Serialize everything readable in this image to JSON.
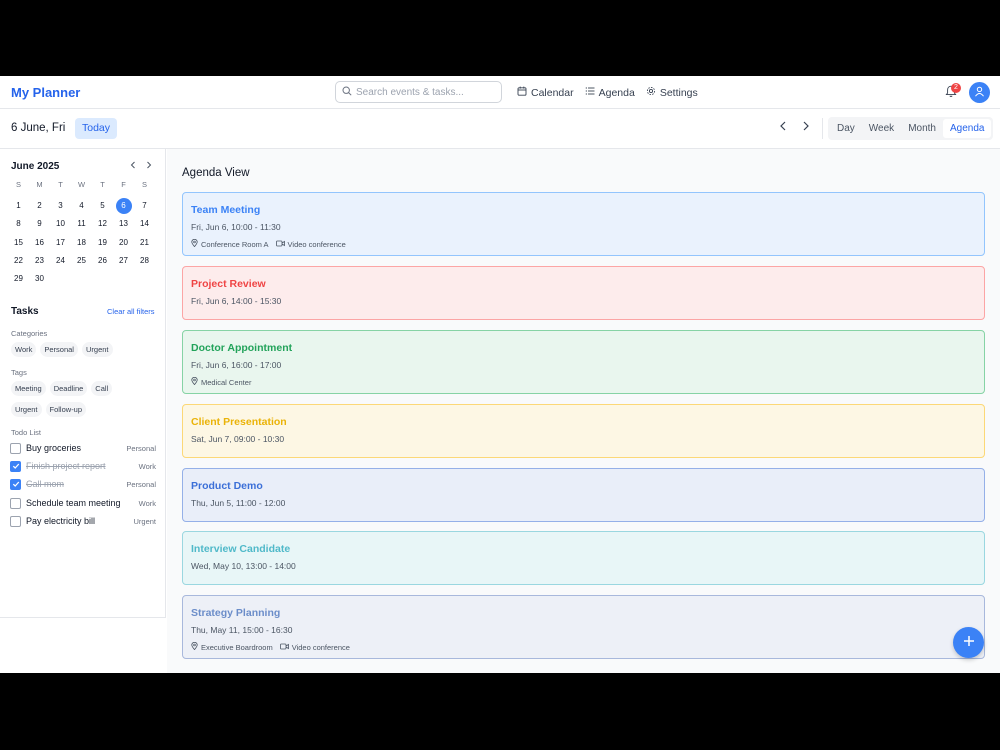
{
  "header": {
    "brand": "My Planner",
    "search_placeholder": "Search events & tasks...",
    "nav": [
      {
        "label": "Calendar",
        "icon": "calendar-icon"
      },
      {
        "label": "Agenda",
        "icon": "list-icon"
      },
      {
        "label": "Settings",
        "icon": "gear-icon"
      }
    ],
    "notification_count": "2"
  },
  "toolbar": {
    "current_date": "6 June, Fri",
    "today_label": "Today",
    "views": [
      "Day",
      "Week",
      "Month",
      "Agenda"
    ],
    "active_view": "Agenda"
  },
  "mini_calendar": {
    "title": "June 2025",
    "weekdays": [
      "S",
      "M",
      "T",
      "W",
      "T",
      "F",
      "S"
    ],
    "days": [
      "1",
      "2",
      "3",
      "4",
      "5",
      "6",
      "7",
      "8",
      "9",
      "10",
      "11",
      "12",
      "13",
      "14",
      "15",
      "16",
      "17",
      "18",
      "19",
      "20",
      "21",
      "22",
      "23",
      "24",
      "25",
      "26",
      "27",
      "28",
      "29",
      "30"
    ],
    "selected_day": "6"
  },
  "tasks": {
    "title": "Tasks",
    "clear_filters": "Clear all filters",
    "categories_label": "Categories",
    "categories": [
      "Work",
      "Personal",
      "Urgent"
    ],
    "tags_label": "Tags",
    "tags_row1": [
      "Meeting",
      "Deadline",
      "Call"
    ],
    "tags_row2": [
      "Urgent",
      "Follow-up"
    ],
    "todo_label": "Todo List",
    "todos": [
      {
        "text": "Buy groceries",
        "category": "Personal",
        "done": false
      },
      {
        "text": "Finish project report",
        "category": "Work",
        "done": true
      },
      {
        "text": "Call mom",
        "category": "Personal",
        "done": true
      },
      {
        "text": "Schedule team meeting",
        "category": "Work",
        "done": false
      },
      {
        "text": "Pay electricity bill",
        "category": "Urgent",
        "done": false
      }
    ]
  },
  "agenda": {
    "title": "Agenda View",
    "events": [
      {
        "title": "Team Meeting",
        "when": "Fri, Jun 6, 10:00 - 11:30",
        "location": "Conference Room A",
        "video": "Video conference",
        "color": "#3b82f6",
        "bg": "#eaf2fd",
        "border": "#93c5fd"
      },
      {
        "title": "Project Review",
        "when": "Fri, Jun 6, 14:00 - 15:30",
        "color": "#ef4444",
        "bg": "#fdecec",
        "border": "#fca5a5"
      },
      {
        "title": "Doctor Appointment",
        "when": "Fri, Jun 6, 16:00 - 17:00",
        "location": "Medical Center",
        "color": "#22a35a",
        "bg": "#e9f6ee",
        "border": "#86d3a5"
      },
      {
        "title": "Client Presentation",
        "when": "Sat, Jun 7, 09:00 - 10:30",
        "color": "#eab308",
        "bg": "#fdf7e4",
        "border": "#fcd877"
      },
      {
        "title": "Product Demo",
        "when": "Thu, Jun 5, 11:00 - 12:00",
        "color": "#3b6fd8",
        "bg": "#e9eef9",
        "border": "#95b0e8"
      },
      {
        "title": "Interview Candidate",
        "when": "Wed, May 10, 13:00 - 14:00",
        "color": "#4fb9c9",
        "bg": "#e8f6f7",
        "border": "#9ad7e0"
      },
      {
        "title": "Strategy Planning",
        "when": "Thu, May 11, 15:00 - 16:30",
        "location": "Executive Boardroom",
        "video": "Video conference",
        "color": "#6b8dc9",
        "bg": "#edf0f7",
        "border": "#a8b8dc"
      }
    ]
  },
  "fab_icon": "plus-icon"
}
